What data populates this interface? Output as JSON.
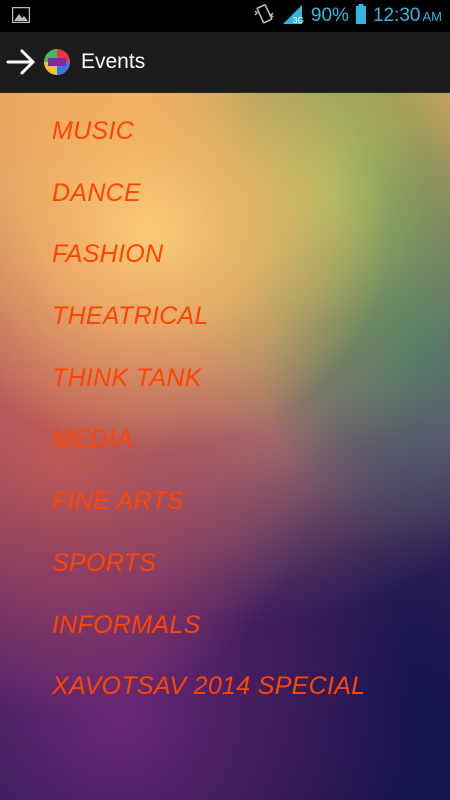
{
  "status_bar": {
    "battery_percent": "90%",
    "time": "12:30",
    "ampm": "AM",
    "icons": [
      "image-notification-icon",
      "vibrate-icon",
      "signal-icon",
      "battery-icon"
    ]
  },
  "action_bar": {
    "title": "Events",
    "icons": [
      "back-arrow-icon",
      "app-logo-icon"
    ]
  },
  "menu": {
    "items": [
      {
        "label": "MUSIC"
      },
      {
        "label": "DANCE"
      },
      {
        "label": "FASHION"
      },
      {
        "label": "THEATRICAL"
      },
      {
        "label": "THINK TANK"
      },
      {
        "label": "MEDIA"
      },
      {
        "label": "FINE ARTS"
      },
      {
        "label": "SPORTS"
      },
      {
        "label": "INFORMALS"
      },
      {
        "label": "XAVOTSAV 2014 SPECIAL"
      }
    ]
  },
  "colors": {
    "status_accent": "#33b5e5",
    "menu_text": "#ff4500",
    "action_bar_bg": "#1c1c1c"
  }
}
